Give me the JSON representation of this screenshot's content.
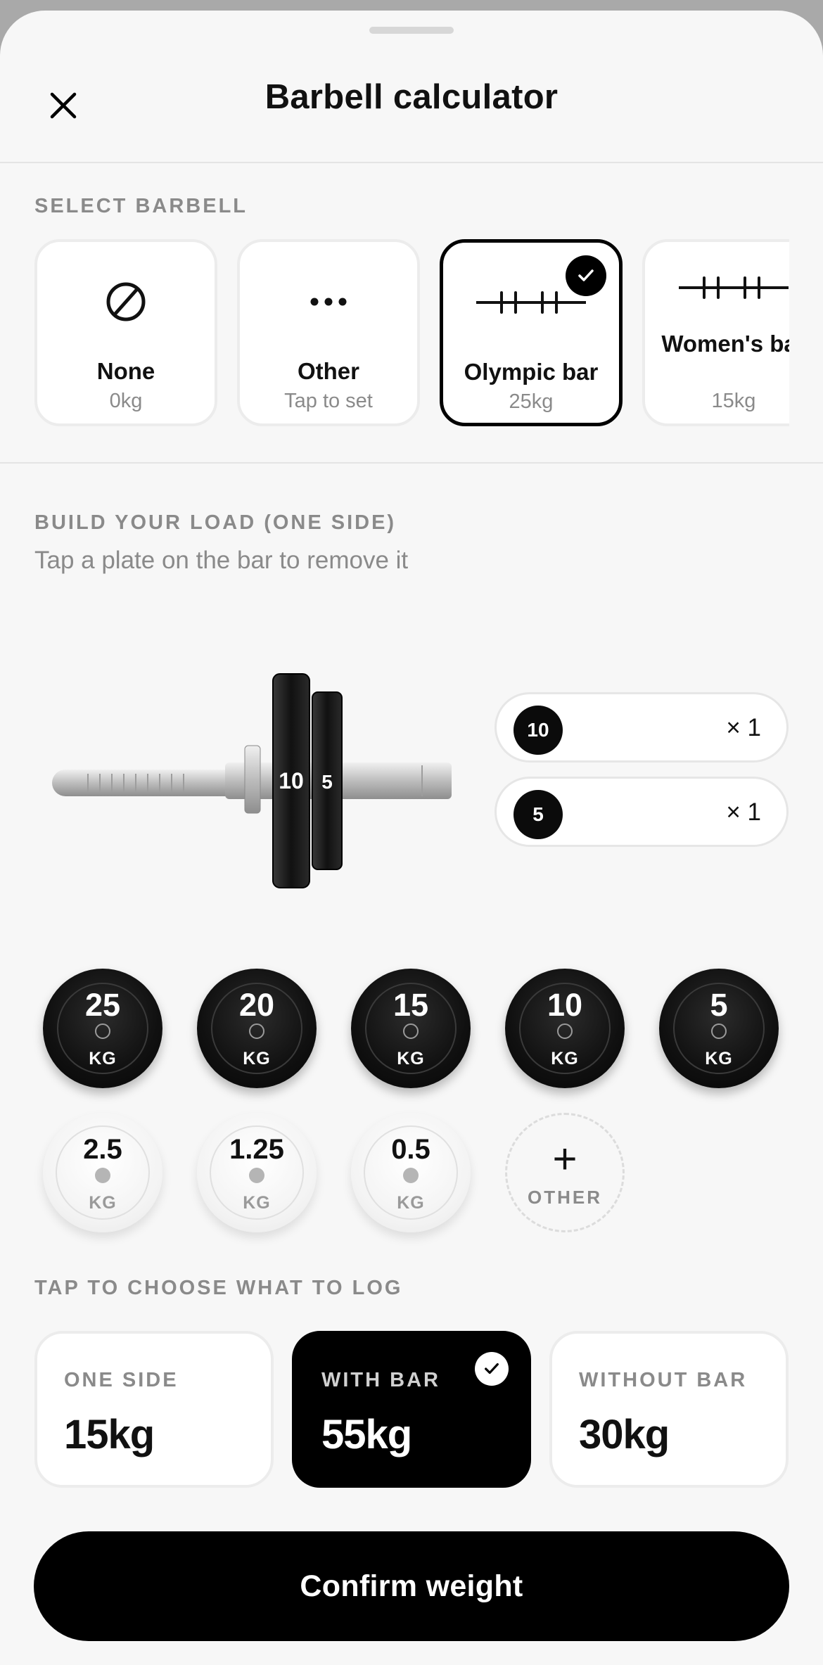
{
  "header": {
    "title": "Barbell calculator"
  },
  "barbell": {
    "section_label": "SELECT BARBELL",
    "options": [
      {
        "name": "None",
        "sub": "0kg",
        "icon": "no-symbol-icon",
        "selected": false
      },
      {
        "name": "Other",
        "sub": "Tap to set",
        "icon": "ellipsis-icon",
        "selected": false
      },
      {
        "name": "Olympic bar",
        "sub": "25kg",
        "icon": "barbell-icon",
        "selected": true
      },
      {
        "name": "Women's bar",
        "sub": "15kg",
        "icon": "barbell-icon",
        "selected": false
      }
    ]
  },
  "load": {
    "section_label": "BUILD YOUR LOAD (ONE SIDE)",
    "hint": "Tap a plate on the bar to remove it",
    "on_bar": [
      {
        "plate": "10",
        "count": "× 1"
      },
      {
        "plate": "5",
        "count": "× 1"
      }
    ],
    "bar_plate_labels": [
      "10",
      "5"
    ]
  },
  "plates": {
    "unit": "KG",
    "dark": [
      "25",
      "20",
      "15",
      "10",
      "5"
    ],
    "light": [
      "2.5",
      "1.25",
      "0.5"
    ],
    "other_label": "OTHER"
  },
  "log": {
    "section_label": "TAP TO CHOOSE WHAT TO LOG",
    "options": [
      {
        "label": "ONE SIDE",
        "value": "15kg",
        "selected": false
      },
      {
        "label": "WITH BAR",
        "value": "55kg",
        "selected": true
      },
      {
        "label": "WITHOUT BAR",
        "value": "30kg",
        "selected": false
      }
    ]
  },
  "confirm_label": "Confirm weight",
  "colors": {
    "accent": "#000000",
    "background": "#f7f7f7",
    "muted": "#8a8a8a"
  }
}
